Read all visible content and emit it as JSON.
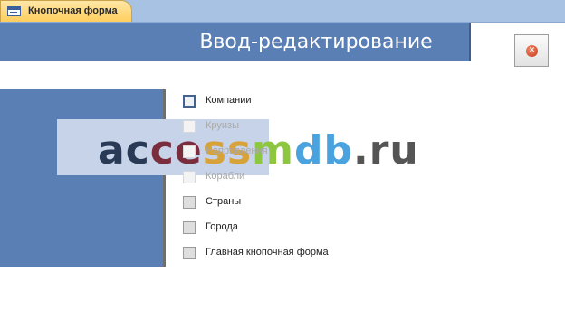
{
  "tab": {
    "label": "Кнопочная форма",
    "icon": "form-icon"
  },
  "header": {
    "title": "Ввод-редактирование"
  },
  "close_button": {
    "icon": "close-icon",
    "glyph": "✕"
  },
  "watermark": {
    "text": "accessmdb.ru"
  },
  "menu": {
    "items": [
      {
        "label": "Компании",
        "state": "active"
      },
      {
        "label": "Круизы",
        "state": "disabled"
      },
      {
        "label": "Направления",
        "state": "disabled"
      },
      {
        "label": "Корабли",
        "state": "disabled"
      },
      {
        "label": "Страны",
        "state": "normal"
      },
      {
        "label": "Города",
        "state": "normal"
      },
      {
        "label": "Главная кнопочная форма",
        "state": "normal"
      }
    ]
  },
  "colors": {
    "header_band": "#5a7fb5",
    "tab_active": "#ffce5e",
    "tabstrip": "#a8c2e4",
    "watermark_colors": [
      "#283a55",
      "#283a55",
      "#7a2d3c",
      "#7a2d3c",
      "#d8a23a",
      "#d8a23a",
      "#8dc63f",
      "#4aa3df",
      "#4aa3df",
      "#555555",
      "#555555",
      "#555555"
    ]
  }
}
